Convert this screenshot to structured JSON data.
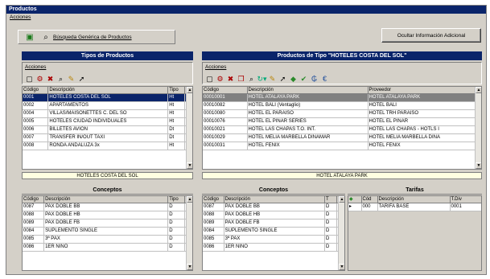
{
  "window": {
    "title": "Productos",
    "menu": "Acciones"
  },
  "toolbar": {
    "search_label": "Búsqueda Genérica de Productos"
  },
  "btn_ocultar": "Ocultar Información Adicional",
  "tipos": {
    "title": "Tipos de Productos",
    "acciones": "Acciones",
    "headers": [
      "Código",
      "Descripción",
      "Tipo"
    ],
    "rows": [
      [
        "0001",
        "HOTELES COSTA DEL SOL",
        "Ht"
      ],
      [
        "0002",
        "APARTAMENTOS",
        "Ht"
      ],
      [
        "0004",
        "VILLAS/MAISONETTES C. DEL SO",
        "Ht"
      ],
      [
        "0005",
        "HOTELES CIUDAD INDIVIDUALES",
        "Ht"
      ],
      [
        "0006",
        "BILLETES AVION",
        "Dt"
      ],
      [
        "0007",
        "TRANSFER IN/OUT TAXI",
        "Dt"
      ],
      [
        "0008",
        "RONDA ANDALUZA 3x",
        "Ht"
      ]
    ],
    "footer_label": "HOTELES COSTA DEL SOL"
  },
  "productos": {
    "title": "Productos de Tipo \"HOTELES COSTA DEL SOL\"",
    "acciones": "Acciones",
    "headers": [
      "Código",
      "Descripción",
      "Proveedor"
    ],
    "rows": [
      [
        "00010001",
        "HOTEL ATALAYA PARK",
        "HOTEL ATALAYA PARK"
      ],
      [
        "00010082",
        "HOTEL BALI (Ventaglio)",
        "HOTEL BALI"
      ],
      [
        "00010080",
        "HOTEL EL PARAISO",
        "HOTEL TRH PARAISO"
      ],
      [
        "00010076",
        "HOTEL EL PINAR SERIES",
        "HOTEL EL PINAR"
      ],
      [
        "00010021",
        "HOTEL LAS CHAPAS T.O. INT.",
        "HOTEL LAS CHAPAS - HOTLS I"
      ],
      [
        "00010029",
        "HOTEL MELIA MARBELLA DINAMAR",
        "HOTEL MELIA MARBELLA DINA"
      ],
      [
        "00010031",
        "HOTEL FENIX",
        "HOTEL FENIX"
      ]
    ],
    "footer_label": "HOTEL ATALAYA PARK"
  },
  "conceptos_left": {
    "title": "Conceptos",
    "headers": [
      "Código",
      "Descripción",
      "Tipo"
    ],
    "rows": [
      [
        "0087",
        "PAX DOBLE BB",
        "D"
      ],
      [
        "0088",
        "PAX DOBLE HB",
        "D"
      ],
      [
        "0089",
        "PAX DOBLE FB",
        "D"
      ],
      [
        "0084",
        "SUPLEMENTO SINGLE",
        "D"
      ],
      [
        "0085",
        "3ª PAX",
        "D"
      ],
      [
        "0086",
        "1ER NIÑO",
        "D"
      ]
    ]
  },
  "conceptos_right": {
    "title": "Conceptos",
    "headers": [
      "Código",
      "Descripción",
      "T"
    ],
    "rows": [
      [
        "0087",
        "PAX DOBLE BB",
        "D"
      ],
      [
        "0088",
        "PAX DOBLE HB",
        "D"
      ],
      [
        "0089",
        "PAX DOBLE FB",
        "D"
      ],
      [
        "0084",
        "SUPLEMENTO SINGLE",
        "D"
      ],
      [
        "0085",
        "3ª PAX",
        "D"
      ],
      [
        "0086",
        "1ER NIÑO",
        "D"
      ]
    ]
  },
  "tarifas": {
    "title": "Tarifas",
    "headers": [
      "Cód",
      "Descripción",
      "T.Div"
    ],
    "rows": [
      [
        "000",
        "TARIFA BASE",
        "0001"
      ]
    ]
  }
}
